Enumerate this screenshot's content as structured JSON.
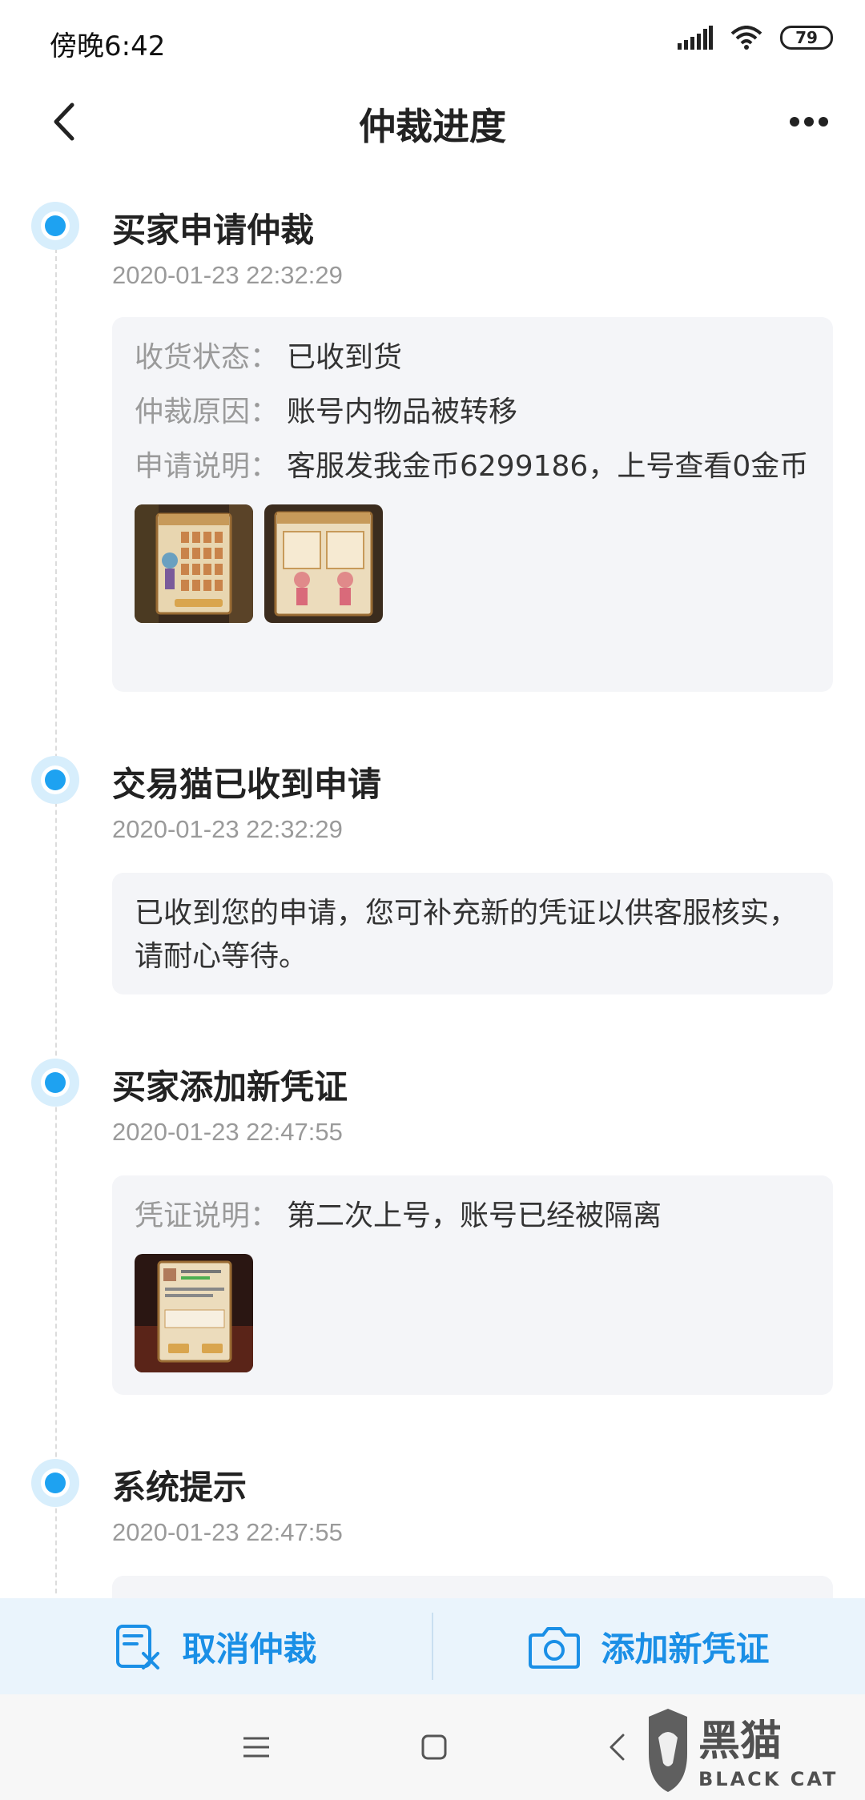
{
  "status_bar": {
    "time": "傍晚6:42",
    "battery": "79"
  },
  "nav": {
    "title": "仲裁进度"
  },
  "timeline": [
    {
      "title": "买家申请仲裁",
      "time": "2020-01-23 22:32:29",
      "fields": [
        {
          "key": "收货状态：",
          "value": "已收到货"
        },
        {
          "key": "仲裁原因：",
          "value": "账号内物品被转移"
        },
        {
          "key": "申请说明：",
          "value": "客服发我金币6299186，上号查看0金币"
        }
      ],
      "image_count": 2
    },
    {
      "title": "交易猫已收到申请",
      "time": "2020-01-23 22:32:29",
      "text": "已收到您的申请，您可补充新的凭证以供客服核实，请耐心等待。"
    },
    {
      "title": "买家添加新凭证",
      "time": "2020-01-23 22:47:55",
      "fields": [
        {
          "key": "凭证说明：",
          "value": "第二次上号，账号已经被隔离"
        }
      ],
      "image_count": 1
    },
    {
      "title": "系统提示",
      "time": "2020-01-23 22:47:55"
    }
  ],
  "actions": {
    "cancel": "取消仲裁",
    "add_evidence": "添加新凭证"
  },
  "watermark": {
    "cn": "黑猫",
    "en": "BLACK CAT"
  },
  "colors": {
    "accent": "#1a8fe6",
    "dot": "#1ea2f1",
    "card_bg": "#f4f5f8"
  }
}
